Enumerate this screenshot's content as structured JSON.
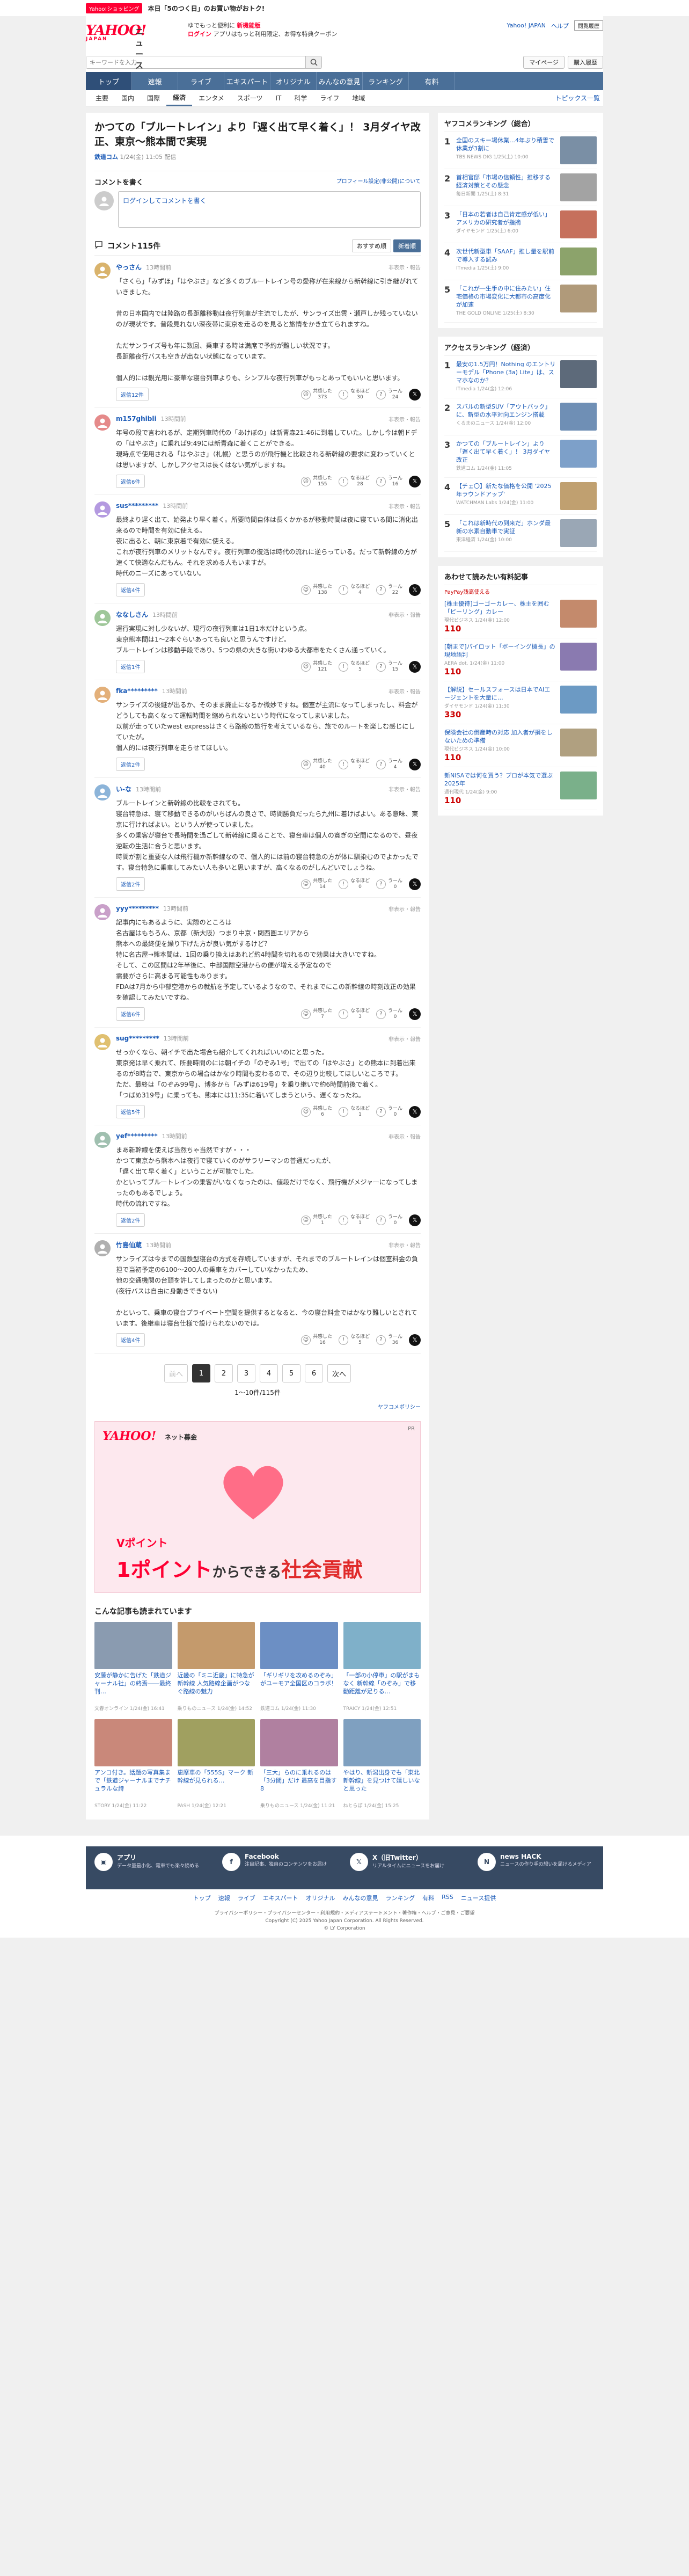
{
  "promo": {
    "tag": "Yahoo!ショッピング",
    "text": "本日「5のつく日」のお買い物がおトク!"
  },
  "header": {
    "logo_main": "YAHOO!",
    "logo_sub": "JAPAN",
    "logo_news": "ニュース",
    "line1": "ゆでもっと便利に",
    "line1_red": "新機能版",
    "line2_a": "ログイン",
    "line2_b": "アプリはもっと利用限定、お得な特典クーポン",
    "right_links": [
      "Yahoo! JAPAN",
      "ヘルプ"
    ],
    "right_box": "閲覧履歴"
  },
  "search": {
    "placeholder": "キーワードを入力",
    "right": [
      "マイページ",
      "購入履歴"
    ]
  },
  "mainnav": [
    "トップ",
    "速報",
    "ライブ",
    "エキスパート",
    "オリジナル",
    "みんなの意見",
    "ランキング",
    "有料"
  ],
  "subnav": [
    "主要",
    "国内",
    "国際",
    "経済",
    "エンタメ",
    "スポーツ",
    "IT",
    "科学",
    "ライフ",
    "地域"
  ],
  "subnav_topics": "トピックス一覧",
  "article": {
    "title": "かつての「ブルートレイン」より「遅く出て早く着く」！ 3月ダイヤ改正、東京〜熊本間で実現",
    "source": "鉄道コム",
    "date": "1/24(金) 11:05 配信"
  },
  "comment_write": {
    "title": "コメントを書く",
    "link": "プロフィール設定(非公開)について",
    "input": "ログインしてコメントを書く"
  },
  "comments_head": {
    "title": "コメント115件",
    "tabs": [
      "おすすめ順",
      "新着順"
    ]
  },
  "comments": [
    {
      "name": "やっさん",
      "time": "13時間前",
      "ops": "非表示・報告",
      "text": "「さくら」「みずほ」「はやぶさ」など多くのブルートレイン号の愛称が在来線から新幹線に引き継がれていきました。\n\n昔の日本国内では陸路の長距離移動は夜行列車が主流でしたが、サンライズ出雲・瀬戸しか残っていないのが現状です。普段見れない深夜帯に東京を走るのを見ると旅情をかき立てられますね。\n\nただサンライズ号も年に数回、乗車する時は満席で予約が難しい状況です。\n長距離夜行バスも空きが出ない状態になっています。\n\n個人的には観光用に豪華な寝台列車よりも、シンプルな夜行列車がもっとあってもいいと思います。",
      "reply": "返信12件",
      "r1": "373",
      "r2": "30",
      "r3": "24"
    },
    {
      "name": "m157ghibli",
      "time": "13時間前",
      "ops": "非表示・報告",
      "text": "年号の段で言われるが、定期列車時代の「あけぼの」は新青森21:46に到着していた。しかし今は朝ドデの「はやぶさ」に乗れば9:49には新青森に着くことができる。\n現時点で使用される「はやぶさ」（札幌）と思うのが飛行機と比較される新幹線の要求に変わっていくとは思いますが、しかしアクセスは長くはない気がしますね。",
      "reply": "返信6件",
      "r1": "155",
      "r2": "28",
      "r3": "16"
    },
    {
      "name": "sus*********",
      "time": "13時間前",
      "ops": "非表示・報告",
      "text": "最終より遅く出て、始発より早く着く。所要時間自体は長くかかるが移動時間は夜に寝ている間に消化出来るので時間を有効に使える。\n夜に出ると、朝に東京着で有効に使える。\nこれが夜行列車のメリットなんです。夜行列車の復活は時代の流れに逆らっている。だって新幹線の方が速くて快適なんだもん。それを求める人もいますが。\n時代のニーズにあっていない。",
      "reply": "返信4件",
      "r1": "138",
      "r2": "4",
      "r3": "22"
    },
    {
      "name": "ななしさん",
      "time": "13時間前",
      "ops": "非表示・報告",
      "text": "運行実現に対し少ないが、現行の夜行列車は1日1本だけという点。\n東京熊本間は1〜2本ぐらいあっても良いと思うんですけど。\nブルートレインは移動手段であり、5つの県の大きな街いわゆる大都市をたくさん通っていく。",
      "reply": "返信1件",
      "r1": "121",
      "r2": "5",
      "r3": "15"
    },
    {
      "name": "fka*********",
      "time": "13時間前",
      "ops": "非表示・報告",
      "text": "サンライズの後継が出るか、そのまま廃止になるか微妙ですね。個室が主流になってしまったし、料金がどうしても高くなって運転時間を縮められないという時代になってしまいました。\n以前が走っていたwest expressはさくら路線の旅行を考えているなら、旅でのルートを楽しむ感じにしていたが。\n個人的には夜行列車を走らせてほしい。",
      "reply": "返信2件",
      "r1": "40",
      "r2": "2",
      "r3": "4"
    },
    {
      "name": "い-な",
      "time": "13時間前",
      "ops": "非表示・報告",
      "text": "ブルートレインと新幹線の比較をされても。\n寝台特急は、寝て移動できるのがいちばんの良さで、時間勝負だったら九州に着けばよい。ある意味、東京に行ければよい。という人が使っていました。\n多くの乗客が寝台で長時間を過ごして新幹線に乗ることで、寝台車は個人の寛ぎの空間になるので、昼夜逆転の生活に合うと思います。\n時間が割と重要な人は飛行機か新幹線なので、個人的には前の寝台特急の方が体に馴染むのでよかったです。寝台特急に乗車してみたい人も多いと思いますが、高くなるのがしんどいでしょうね。",
      "reply": "返信2件",
      "r1": "14",
      "r2": "0",
      "r3": "0"
    },
    {
      "name": "yyy*********",
      "time": "13時間前",
      "ops": "非表示・報告",
      "text": "記事内にもあるように、実際のところは\n名古屋はもちろん、京都（新大阪）つまり中京・関西圏エリアから\n熊本への最終便を繰り下げた方が良い気がするけど？\n特に名古屋→熊本間は、1回の乗り換えはあれど約4時間を切れるので効果は大きいですね。\nそして、この区間は2年半後に、中部国際空港からの便が増える予定なので\n需要がさらに高まる可能性もあります。\nFDAは7月から中部空港からの就航を予定しているようなので、それまでにこの新幹線の時刻改正の効果を確認してみたいですね。",
      "reply": "返信6件",
      "r1": "7",
      "r2": "3",
      "r3": "0"
    },
    {
      "name": "sug*********",
      "time": "13時間前",
      "ops": "非表示・報告",
      "text": "せっかくなら、朝イチで出た場合も紹介してくれればいいのにと思った。\n東京発は早く乗れて、所要時間のには朝イチの「のぞみ1号」で出ての「はやぶさ」との熊本に到着出来るのが8時台で、東京からの場合はかなり時間も変わるので、その辺り比較してほしいところです。\nただ、最終は「のぞみ99号」、博多から「みずほ619号」を乗り継いで約6時間前後で着く。\n「つばめ319号」に乗っても、熊本には11:35に着いてしまうという、遅くなったね。",
      "reply": "返信5件",
      "r1": "6",
      "r2": "1",
      "r3": "0"
    },
    {
      "name": "yef*********",
      "time": "13時間前",
      "ops": "非表示・報告",
      "text": "まあ新幹線を使えば当然ちゃ当然ですが・・・\nかつて東京から熊本へは夜行で寝ていくのがサラリーマンの普通だったが、\n「遅く出て早く着く」ということが可能でした。\nかといってブルートレインの乗客がいなくなったのは、値段だけでなく、飛行機がメジャーになってしまったのもあるでしょう。\n時代の流れですね。",
      "reply": "返信2件",
      "r1": "1",
      "r2": "1",
      "r3": "0"
    },
    {
      "name": "竹島仙蔵",
      "time": "13時間前",
      "ops": "非表示・報告",
      "text": "サンライズは今までの国鉄型寝台の方式を存続していますが、それまでのブルートレインは個室料金の負担で当初予定の6100〜200人の乗車をカバーしていなかったため、\n他の交通機関の台頭を許してしまったのかと思います。\n(夜行バスは自由に身動きできない)\n\nかといって、乗車の寝台プライベート空間を提供するとなると、今の寝台料金ではかなり難しいとされています。後継車は寝台仕様で設けられないのでは。",
      "reply": "返信4件",
      "r1": "16",
      "r2": "5",
      "r3": "36"
    }
  ],
  "react_labels": {
    "r1": "共感した",
    "r2": "なるほど",
    "r3": "うーん"
  },
  "reply_prefix": "返信",
  "pager": {
    "prev": "前へ",
    "pages": [
      "1",
      "2",
      "3",
      "4",
      "5",
      "6"
    ],
    "next": "次へ",
    "info": "1〜10件/115件"
  },
  "policy": "ヤフコメポリシー",
  "banner": {
    "logo": "YAHOO!",
    "sub": "ネット募金",
    "adtag": "PR",
    "v": "Vポイント",
    "big_a": "1ポイント",
    "big_b": "からできる",
    "big_c": "社会貢献"
  },
  "recommend": {
    "title": "こんな記事も読まれています",
    "items": [
      {
        "cap": "安藤が静かに告げた「鉄道ジャーナル社」の終焉――最終刊…",
        "src": "文春オンライン 1/24(金) 16:41"
      },
      {
        "cap": "近畿の「ミニ近畿」に特急が新幹線 人気路線企画がつなぐ路線の魅力",
        "src": "乗りものニュース 1/24(金) 14:52"
      },
      {
        "cap": "「ギリギリを攻めるのぞみ」がユーモア全国区のコラボ！",
        "src": "鉄道コム 1/24(金) 11:30"
      },
      {
        "cap": "「一部の小停車」の駅がまもなく 新幹線「のぞみ」で移動距離が足りる…",
        "src": "TRAICY 1/24(金) 12:51"
      },
      {
        "cap": "アンコ付き。話題の写真集まで「鉄道ジャーナルまでナチュラルな詩",
        "src": "STORY 1/24(金) 11:22"
      },
      {
        "cap": "恵摩車の「555S」マーク 新幹線が見られる…",
        "src": "PASH 1/24(金) 12:21"
      },
      {
        "cap": "「三大」らのに乗れるのは「3分間」だけ 最高を目指す 8",
        "src": "乗りものニュース 1/24(金) 11:21"
      },
      {
        "cap": "やはり、新潟出身でも「東北新幹線」を見つけて嬉しいなと思った",
        "src": "ねとらぼ 1/24(金) 15:25"
      }
    ]
  },
  "side_ranking": {
    "title": "ヤフコメランキング（総合）",
    "items": [
      {
        "num": "1",
        "text": "全国のスキー場休業…4年ぶり積雪で休業が3割に",
        "src": "TBS NEWS DIG 1/25(土) 10:00"
      },
      {
        "num": "2",
        "text": "首相官邸「市場の信頼性」推移する経済対策とその懸念",
        "src": "毎日新聞 1/25(土) 8:31"
      },
      {
        "num": "3",
        "text": "「日本の若者は自己肯定感が低い」アメリカの研究者が指摘",
        "src": "ダイヤモンド 1/25(土) 6:00"
      },
      {
        "num": "4",
        "text": "次世代新型車「SAAF」推し量を駅前で導入する試み",
        "src": "ITmedia 1/25(土) 9:00"
      },
      {
        "num": "5",
        "text": "「これが一生手の中に住みたい」住宅価格の市場変化に大都市の高度化が加速",
        "src": "THE GOLD ONLINE 1/25(土) 8:30"
      }
    ]
  },
  "side_access": {
    "title": "アクセスランキング（経済）",
    "items": [
      {
        "num": "1",
        "text": "最安の1.5万円！Nothing のエントリーモデル「Phone (3a) Lite」は、スマホなのか？",
        "src": "ITmedia 1/24(金) 12:06"
      },
      {
        "num": "2",
        "text": "スバルの新型SUV「アウトバック」に、新型の水平対向エンジン搭載",
        "src": "くるまのニュース 1/24(金) 12:00"
      },
      {
        "num": "3",
        "text": "かつての「ブルートレイン」より「遅く出て早く着く」！ 3月ダイヤ改正",
        "src": "鉄道コム 1/24(金) 11:05"
      },
      {
        "num": "4",
        "text": "【チェ〇】新たな価格を公開 '2025年ラウンドアップ'",
        "src": "WATCHMAN Labs 1/24(金) 11:00"
      },
      {
        "num": "5",
        "text": "「これは新時代の到来だ」ホンダ最新の水素自動車で実証",
        "src": "東洋経済 1/24(金) 10:00"
      }
    ]
  },
  "side_ads": {
    "title": "あわせて読みたい有料記事",
    "paypay": "PayPay残高使える",
    "items": [
      {
        "text": "[株主優待]ゴーゴーカレー、株主を囲む「ピーリング」カレー",
        "src": "現代ビジネス 1/24(金) 12:00",
        "price": "110"
      },
      {
        "text": "[朝まで]パイロット「ボーイング機長」の現地語判",
        "src": "AERA dot. 1/24(金) 11:00",
        "price": "110"
      },
      {
        "text": "【解説】セールスフォースは日本でAIエージェントを大量に…",
        "src": "ダイヤモンド 1/24(金) 11:30",
        "price": "330"
      },
      {
        "text": "保険会社の倒産時の対応 加入者が損をしないための準備",
        "src": "現代ビジネス 1/24(金) 10:00",
        "price": "110"
      },
      {
        "text": "新NISAでは何を買う？プロが本気で選ぶ2025年",
        "src": "週刊現代 1/24(金) 9:00",
        "price": "110"
      }
    ]
  },
  "footer": {
    "blocks": [
      {
        "title": "アプリ",
        "desc": "データ量最小化、電車でも楽々読める"
      },
      {
        "title": "Facebook",
        "desc": "注目記事、独自のコンテンツをお届け"
      },
      {
        "title": "X（旧Twitter）",
        "desc": "リアルタイムにニュースをお届け"
      },
      {
        "title": "news HACK",
        "desc": "ニュースの作り手の想いを届けるメディア"
      }
    ],
    "links": [
      "トップ",
      "速報",
      "ライブ",
      "エキスパート",
      "オリジナル",
      "みんなの意見",
      "ランキング",
      "有料",
      "RSS",
      "ニュース提供"
    ],
    "bottom1": "プライバシーポリシー・プライバシーセンター・利用規約・メディアステートメント・著作権・ヘルプ・ご意見・ご要望",
    "bottom2": "Copyright (C) 2025 Yahoo Japan Corporation. All Rights Reserved.",
    "bottom3": "© LY Corporation"
  },
  "colors": {
    "brand_red": "#ff0033",
    "nav_blue": "#4a6f98",
    "link": "#1a5ab7"
  }
}
